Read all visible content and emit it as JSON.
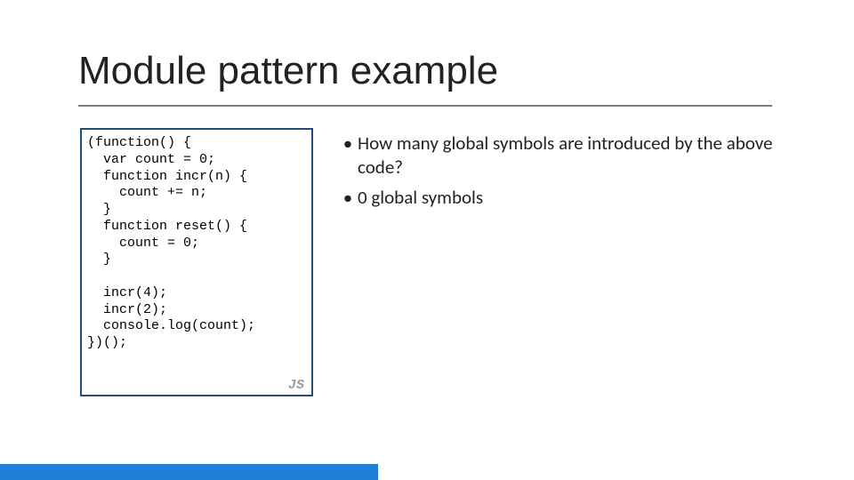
{
  "title": "Module pattern example",
  "code": {
    "lang": "JS",
    "lines": [
      "(function() {",
      "  var count = 0;",
      "  function incr(n) {",
      "    count += n;",
      "  }",
      "  function reset() {",
      "    count = 0;",
      "  }",
      "",
      "  incr(4);",
      "  incr(2);",
      "  console.log(count);",
      "})();"
    ]
  },
  "bullets": [
    "How many global symbols are introduced by the above code?",
    "0 global symbols"
  ]
}
